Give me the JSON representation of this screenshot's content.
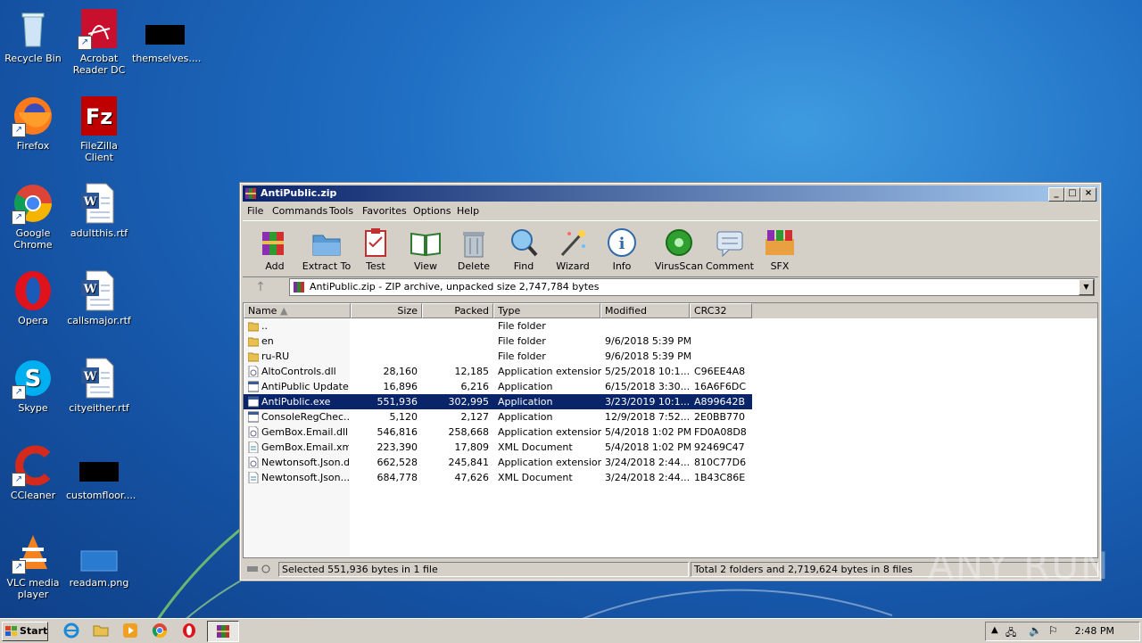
{
  "desktop": {
    "icons": [
      {
        "label": "Recycle Bin"
      },
      {
        "label": "Acrobat Reader DC"
      },
      {
        "label": "themselves...."
      },
      {
        "label": "Firefox"
      },
      {
        "label": "FileZilla Client"
      },
      {
        "label": "Google Chrome"
      },
      {
        "label": "adultthis.rtf"
      },
      {
        "label": "Opera"
      },
      {
        "label": "callsmajor.rtf"
      },
      {
        "label": "Skype"
      },
      {
        "label": "cityeither.rtf"
      },
      {
        "label": "CCleaner"
      },
      {
        "label": "customfloor...."
      },
      {
        "label": "VLC media player"
      },
      {
        "label": "readam.png"
      }
    ]
  },
  "window": {
    "title": "AntiPublic.zip",
    "controls": {
      "minimize": "_",
      "maximize": "□",
      "close": "×"
    },
    "menu": [
      "File",
      "Commands",
      "Tools",
      "Favorites",
      "Options",
      "Help"
    ],
    "toolbar": [
      "Add",
      "Extract To",
      "Test",
      "View",
      "Delete",
      "Find",
      "Wizard",
      "Info",
      "VirusScan",
      "Comment",
      "SFX"
    ],
    "address": "AntiPublic.zip - ZIP archive, unpacked size 2,747,784 bytes",
    "columns": {
      "name": "Name",
      "size": "Size",
      "packed": "Packed",
      "type": "Type",
      "modified": "Modified",
      "crc": "CRC32"
    },
    "files": [
      {
        "name": "..",
        "size": "",
        "packed": "",
        "type": "File folder",
        "modified": "",
        "crc": "",
        "icon": "folder-up"
      },
      {
        "name": "en",
        "size": "",
        "packed": "",
        "type": "File folder",
        "modified": "9/6/2018 5:39 PM",
        "crc": "",
        "icon": "folder"
      },
      {
        "name": "ru-RU",
        "size": "",
        "packed": "",
        "type": "File folder",
        "modified": "9/6/2018 5:39 PM",
        "crc": "",
        "icon": "folder"
      },
      {
        "name": "AltoControls.dll",
        "size": "28,160",
        "packed": "12,185",
        "type": "Application extension",
        "modified": "5/25/2018 10:1...",
        "crc": "C96EE4A8",
        "icon": "dll"
      },
      {
        "name": "AntiPublic Update...",
        "size": "16,896",
        "packed": "6,216",
        "type": "Application",
        "modified": "6/15/2018 3:30...",
        "crc": "16A6F6DC",
        "icon": "exe"
      },
      {
        "name": "AntiPublic.exe",
        "size": "551,936",
        "packed": "302,995",
        "type": "Application",
        "modified": "3/23/2019 10:1...",
        "crc": "A899642B",
        "icon": "exe",
        "selected": true
      },
      {
        "name": "ConsoleRegChec...",
        "size": "5,120",
        "packed": "2,127",
        "type": "Application",
        "modified": "12/9/2018 7:52...",
        "crc": "2E0BB770",
        "icon": "exe"
      },
      {
        "name": "GemBox.Email.dll",
        "size": "546,816",
        "packed": "258,668",
        "type": "Application extension",
        "modified": "5/4/2018 1:02 PM",
        "crc": "FD0A08D8",
        "icon": "dll"
      },
      {
        "name": "GemBox.Email.xml",
        "size": "223,390",
        "packed": "17,809",
        "type": "XML Document",
        "modified": "5/4/2018 1:02 PM",
        "crc": "92469C47",
        "icon": "xml"
      },
      {
        "name": "Newtonsoft.Json.dll",
        "size": "662,528",
        "packed": "245,841",
        "type": "Application extension",
        "modified": "3/24/2018 2:44...",
        "crc": "810C77D6",
        "icon": "dll"
      },
      {
        "name": "Newtonsoft.Json....",
        "size": "684,778",
        "packed": "47,626",
        "type": "XML Document",
        "modified": "3/24/2018 2:44...",
        "crc": "1B43C86E",
        "icon": "xml"
      }
    ],
    "status_left": "Selected 551,936 bytes in 1 file",
    "status_right": "Total 2 folders and 2,719,624 bytes in 8 files"
  },
  "taskbar": {
    "start": "Start",
    "clock": "2:48 PM"
  },
  "watermark": "ANY RUN"
}
